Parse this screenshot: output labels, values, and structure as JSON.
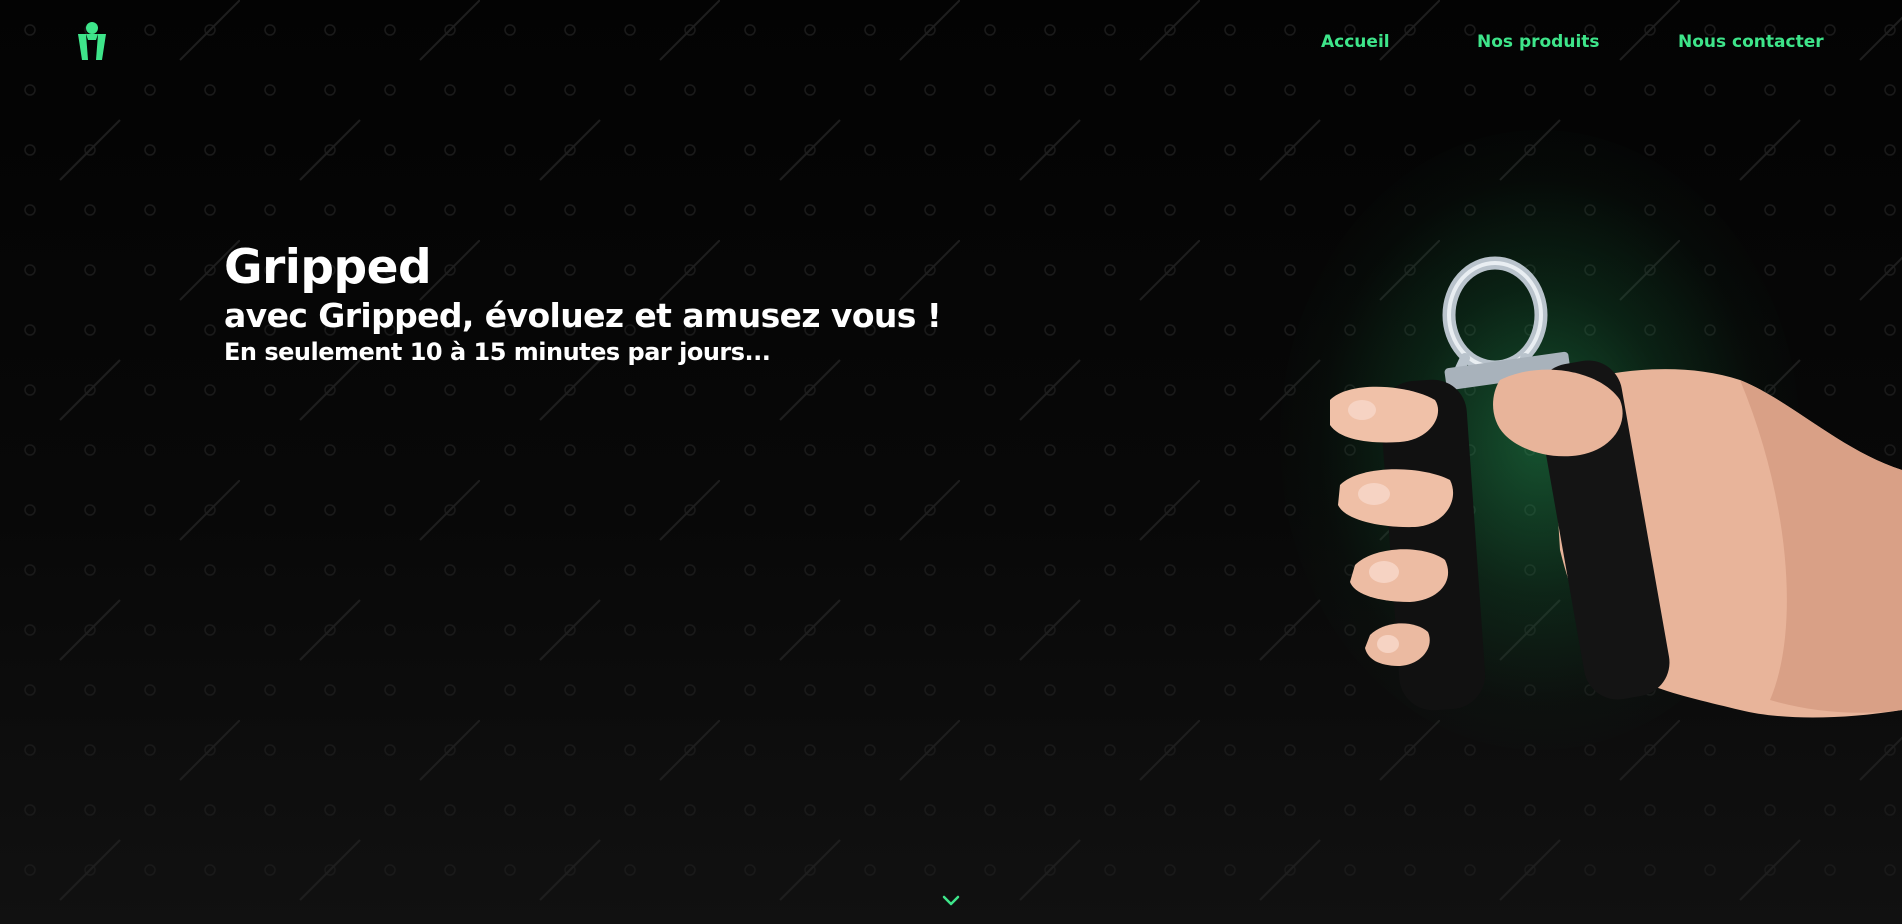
{
  "nav": {
    "items": [
      {
        "label": "Accueil"
      },
      {
        "label": "Nos produits"
      },
      {
        "label": "Nous contacter"
      }
    ]
  },
  "hero": {
    "title": "Gripped",
    "subtitle": "avec Gripped, évoluez et amusez vous !",
    "tagline": "En seulement 10 à 15 minutes par jours..."
  },
  "icons": {
    "logo": "gripped-logo-icon",
    "scroll": "chevron-down-icon"
  },
  "colors": {
    "accent": "#3ee58a",
    "background": "#0a0a0a",
    "text": "#ffffff"
  }
}
